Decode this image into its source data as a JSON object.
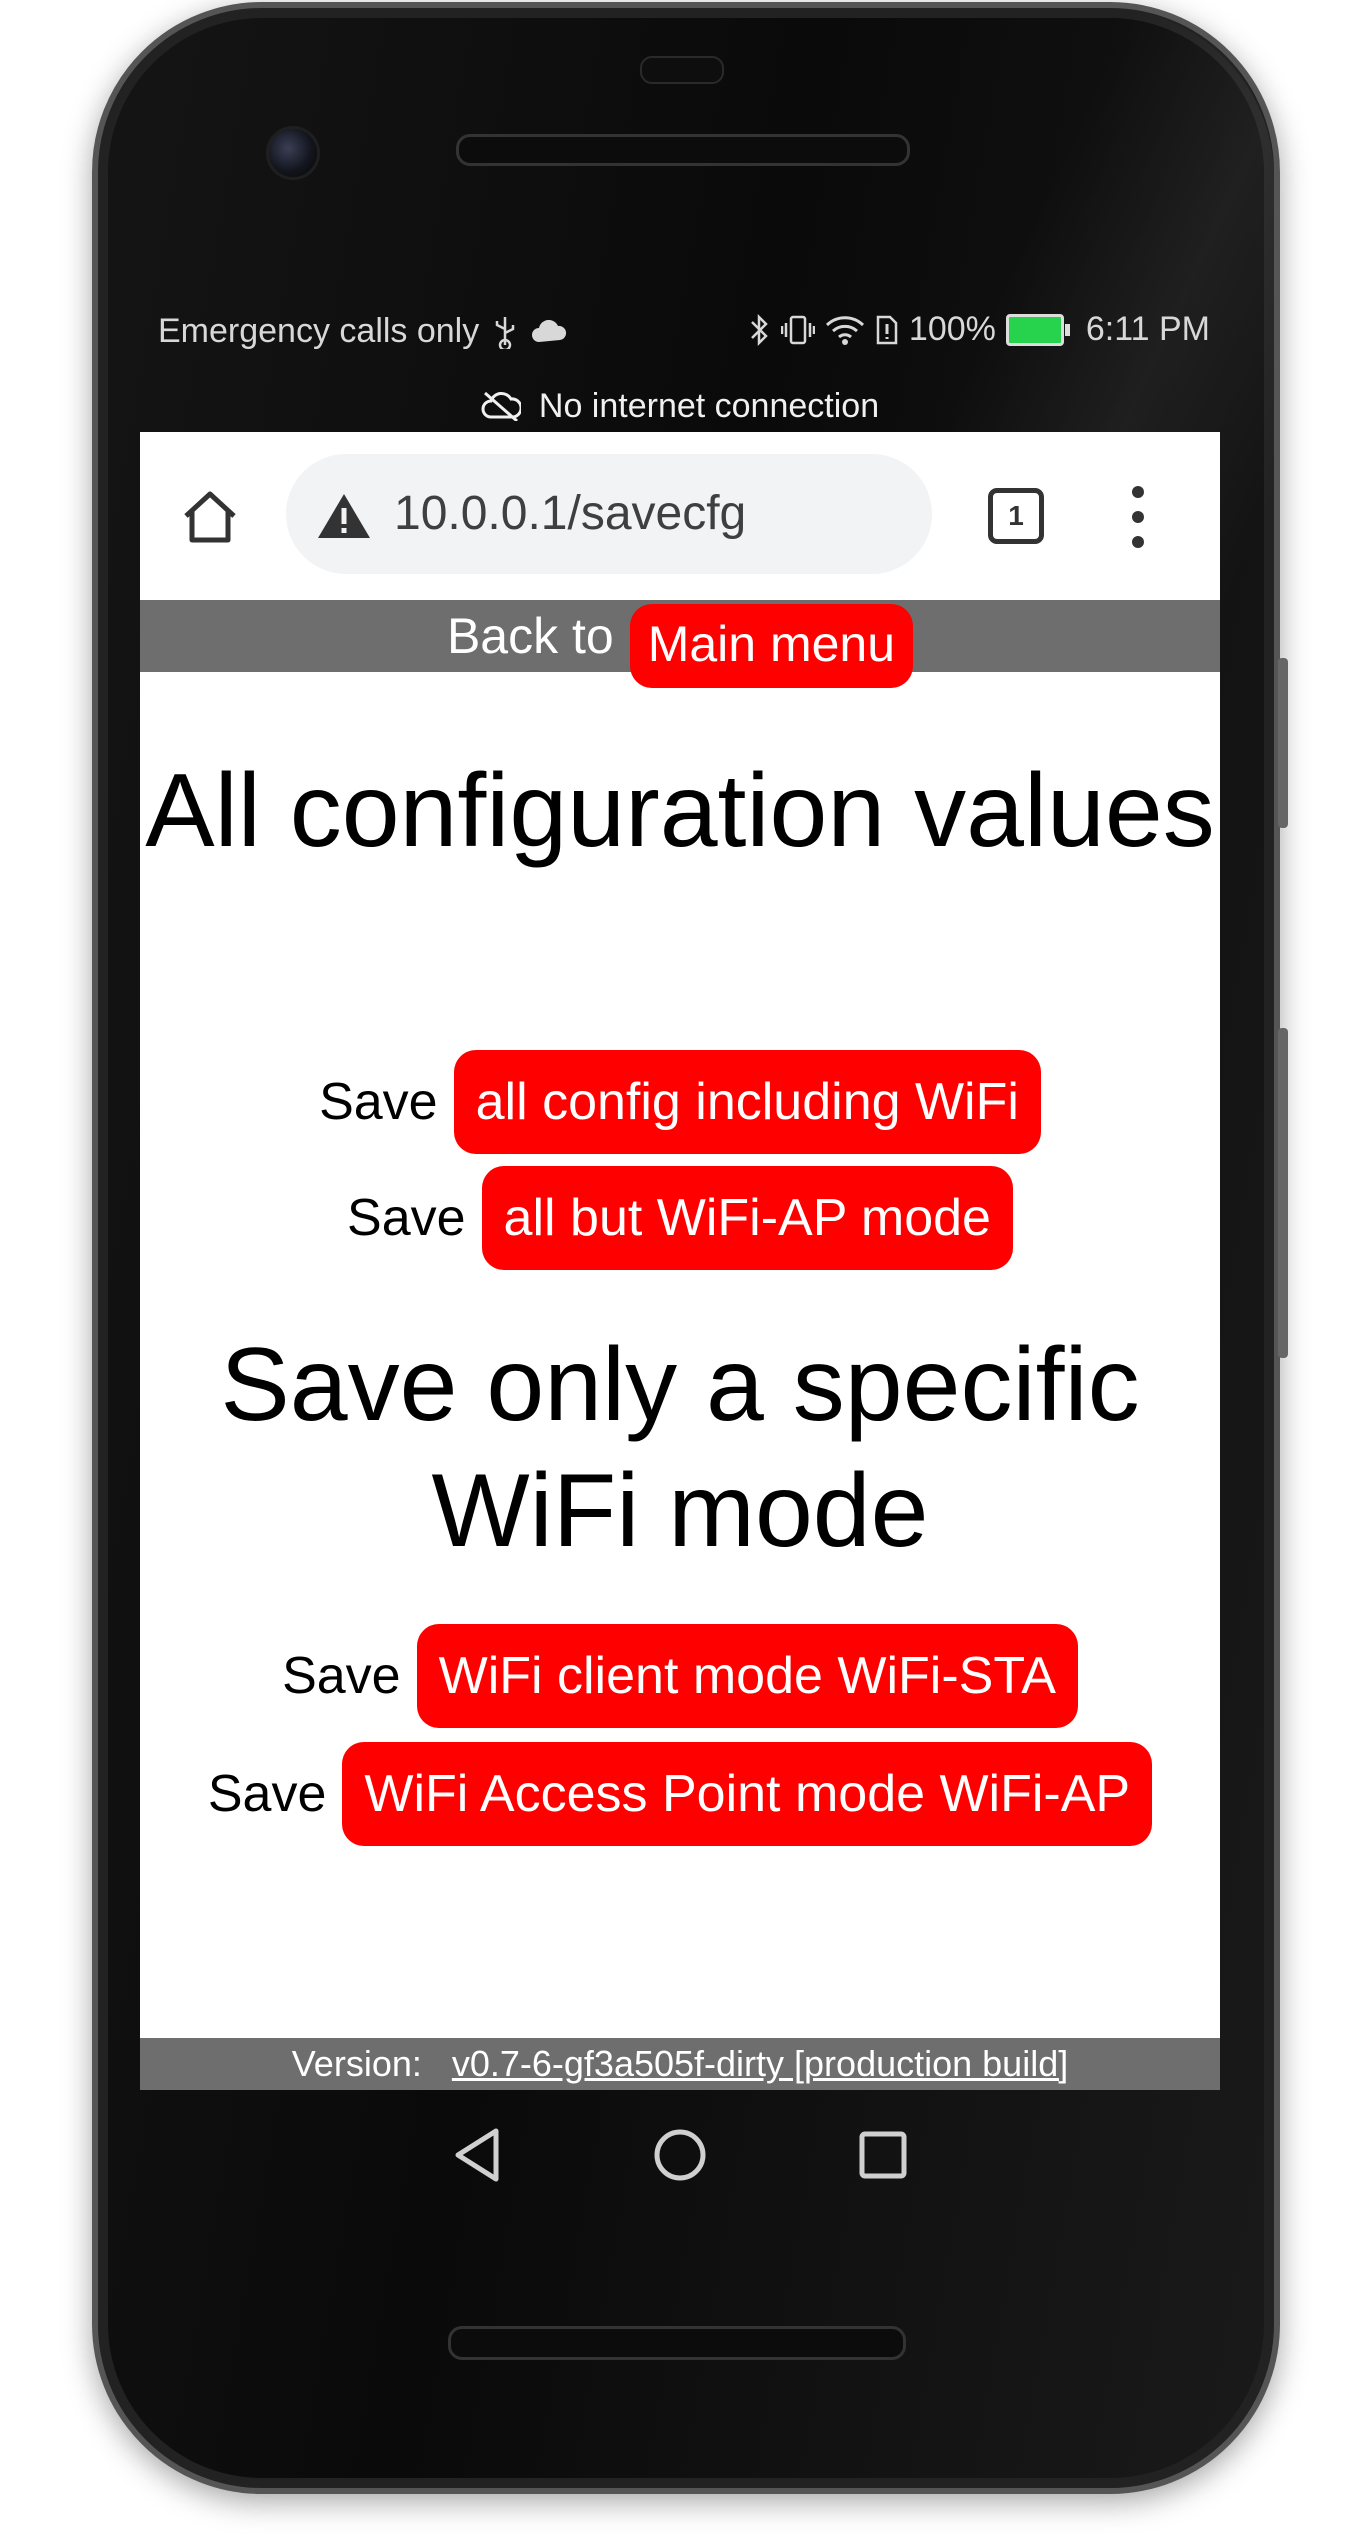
{
  "status_bar": {
    "carrier_text": "Emergency calls only",
    "battery_percent": "100%",
    "time": "6:11 PM",
    "icons": [
      "usb-icon",
      "cloud-icon",
      "bluetooth-icon",
      "vibrate-icon",
      "wifi-icon",
      "sim-icon",
      "battery-icon"
    ]
  },
  "network_notice": "No internet connection",
  "browser": {
    "url": "10.0.0.1/savecfg",
    "tab_count": "1"
  },
  "top_nav": {
    "back_label": "Back to",
    "main_menu_label": "Main menu"
  },
  "section_all": {
    "title": "All configuration values",
    "rows": [
      {
        "label": "Save",
        "button": "all config including WiFi"
      },
      {
        "label": "Save",
        "button": "all but WiFi-AP mode"
      }
    ]
  },
  "section_wifi": {
    "title": "Save only a specific WiFi mode",
    "rows": [
      {
        "label": "Save",
        "button": "WiFi client mode WiFi-STA"
      },
      {
        "label": "Save",
        "button": "WiFi Access Point mode WiFi-AP"
      }
    ]
  },
  "footer": {
    "version_label": "Version:",
    "version_value": "v0.7-6-gf3a505f-dirty [production build]"
  },
  "colors": {
    "accent_red": "#ff0000",
    "nav_gray": "#6e6e6e",
    "battery_green": "#27d34d"
  }
}
